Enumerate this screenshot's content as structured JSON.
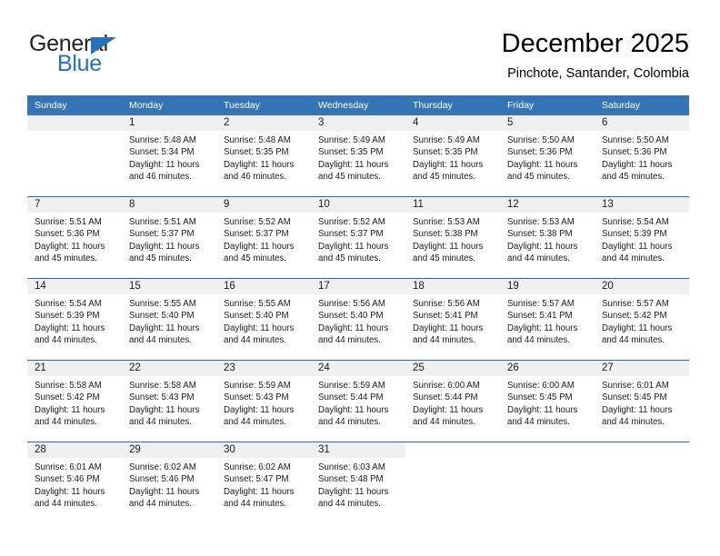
{
  "brand": {
    "name_top": "General",
    "name_bottom": "Blue",
    "color_blue": "#2572b8",
    "triangle_icon": "triangle-icon"
  },
  "header": {
    "title": "December 2025",
    "location": "Pinchote, Santander, Colombia"
  },
  "theme": {
    "header_blue": "#3575b5",
    "row_divider_blue": "#2a6ca8",
    "day_band_gray": "#f0f0f0"
  },
  "weekday_headers": [
    "Sunday",
    "Monday",
    "Tuesday",
    "Wednesday",
    "Thursday",
    "Friday",
    "Saturday"
  ],
  "weeks": [
    [
      {
        "blank": true
      },
      {
        "day": "1",
        "sunrise": "Sunrise: 5:48 AM",
        "sunset": "Sunset: 5:34 PM",
        "daylight_1": "Daylight: 11 hours",
        "daylight_2": "and 46 minutes."
      },
      {
        "day": "2",
        "sunrise": "Sunrise: 5:48 AM",
        "sunset": "Sunset: 5:35 PM",
        "daylight_1": "Daylight: 11 hours",
        "daylight_2": "and 46 minutes."
      },
      {
        "day": "3",
        "sunrise": "Sunrise: 5:49 AM",
        "sunset": "Sunset: 5:35 PM",
        "daylight_1": "Daylight: 11 hours",
        "daylight_2": "and 45 minutes."
      },
      {
        "day": "4",
        "sunrise": "Sunrise: 5:49 AM",
        "sunset": "Sunset: 5:35 PM",
        "daylight_1": "Daylight: 11 hours",
        "daylight_2": "and 45 minutes."
      },
      {
        "day": "5",
        "sunrise": "Sunrise: 5:50 AM",
        "sunset": "Sunset: 5:36 PM",
        "daylight_1": "Daylight: 11 hours",
        "daylight_2": "and 45 minutes."
      },
      {
        "day": "6",
        "sunrise": "Sunrise: 5:50 AM",
        "sunset": "Sunset: 5:36 PM",
        "daylight_1": "Daylight: 11 hours",
        "daylight_2": "and 45 minutes."
      }
    ],
    [
      {
        "day": "7",
        "sunrise": "Sunrise: 5:51 AM",
        "sunset": "Sunset: 5:36 PM",
        "daylight_1": "Daylight: 11 hours",
        "daylight_2": "and 45 minutes."
      },
      {
        "day": "8",
        "sunrise": "Sunrise: 5:51 AM",
        "sunset": "Sunset: 5:37 PM",
        "daylight_1": "Daylight: 11 hours",
        "daylight_2": "and 45 minutes."
      },
      {
        "day": "9",
        "sunrise": "Sunrise: 5:52 AM",
        "sunset": "Sunset: 5:37 PM",
        "daylight_1": "Daylight: 11 hours",
        "daylight_2": "and 45 minutes."
      },
      {
        "day": "10",
        "sunrise": "Sunrise: 5:52 AM",
        "sunset": "Sunset: 5:37 PM",
        "daylight_1": "Daylight: 11 hours",
        "daylight_2": "and 45 minutes."
      },
      {
        "day": "11",
        "sunrise": "Sunrise: 5:53 AM",
        "sunset": "Sunset: 5:38 PM",
        "daylight_1": "Daylight: 11 hours",
        "daylight_2": "and 45 minutes."
      },
      {
        "day": "12",
        "sunrise": "Sunrise: 5:53 AM",
        "sunset": "Sunset: 5:38 PM",
        "daylight_1": "Daylight: 11 hours",
        "daylight_2": "and 44 minutes."
      },
      {
        "day": "13",
        "sunrise": "Sunrise: 5:54 AM",
        "sunset": "Sunset: 5:39 PM",
        "daylight_1": "Daylight: 11 hours",
        "daylight_2": "and 44 minutes."
      }
    ],
    [
      {
        "day": "14",
        "sunrise": "Sunrise: 5:54 AM",
        "sunset": "Sunset: 5:39 PM",
        "daylight_1": "Daylight: 11 hours",
        "daylight_2": "and 44 minutes."
      },
      {
        "day": "15",
        "sunrise": "Sunrise: 5:55 AM",
        "sunset": "Sunset: 5:40 PM",
        "daylight_1": "Daylight: 11 hours",
        "daylight_2": "and 44 minutes."
      },
      {
        "day": "16",
        "sunrise": "Sunrise: 5:55 AM",
        "sunset": "Sunset: 5:40 PM",
        "daylight_1": "Daylight: 11 hours",
        "daylight_2": "and 44 minutes."
      },
      {
        "day": "17",
        "sunrise": "Sunrise: 5:56 AM",
        "sunset": "Sunset: 5:40 PM",
        "daylight_1": "Daylight: 11 hours",
        "daylight_2": "and 44 minutes."
      },
      {
        "day": "18",
        "sunrise": "Sunrise: 5:56 AM",
        "sunset": "Sunset: 5:41 PM",
        "daylight_1": "Daylight: 11 hours",
        "daylight_2": "and 44 minutes."
      },
      {
        "day": "19",
        "sunrise": "Sunrise: 5:57 AM",
        "sunset": "Sunset: 5:41 PM",
        "daylight_1": "Daylight: 11 hours",
        "daylight_2": "and 44 minutes."
      },
      {
        "day": "20",
        "sunrise": "Sunrise: 5:57 AM",
        "sunset": "Sunset: 5:42 PM",
        "daylight_1": "Daylight: 11 hours",
        "daylight_2": "and 44 minutes."
      }
    ],
    [
      {
        "day": "21",
        "sunrise": "Sunrise: 5:58 AM",
        "sunset": "Sunset: 5:42 PM",
        "daylight_1": "Daylight: 11 hours",
        "daylight_2": "and 44 minutes."
      },
      {
        "day": "22",
        "sunrise": "Sunrise: 5:58 AM",
        "sunset": "Sunset: 5:43 PM",
        "daylight_1": "Daylight: 11 hours",
        "daylight_2": "and 44 minutes."
      },
      {
        "day": "23",
        "sunrise": "Sunrise: 5:59 AM",
        "sunset": "Sunset: 5:43 PM",
        "daylight_1": "Daylight: 11 hours",
        "daylight_2": "and 44 minutes."
      },
      {
        "day": "24",
        "sunrise": "Sunrise: 5:59 AM",
        "sunset": "Sunset: 5:44 PM",
        "daylight_1": "Daylight: 11 hours",
        "daylight_2": "and 44 minutes."
      },
      {
        "day": "25",
        "sunrise": "Sunrise: 6:00 AM",
        "sunset": "Sunset: 5:44 PM",
        "daylight_1": "Daylight: 11 hours",
        "daylight_2": "and 44 minutes."
      },
      {
        "day": "26",
        "sunrise": "Sunrise: 6:00 AM",
        "sunset": "Sunset: 5:45 PM",
        "daylight_1": "Daylight: 11 hours",
        "daylight_2": "and 44 minutes."
      },
      {
        "day": "27",
        "sunrise": "Sunrise: 6:01 AM",
        "sunset": "Sunset: 5:45 PM",
        "daylight_1": "Daylight: 11 hours",
        "daylight_2": "and 44 minutes."
      }
    ],
    [
      {
        "day": "28",
        "sunrise": "Sunrise: 6:01 AM",
        "sunset": "Sunset: 5:46 PM",
        "daylight_1": "Daylight: 11 hours",
        "daylight_2": "and 44 minutes."
      },
      {
        "day": "29",
        "sunrise": "Sunrise: 6:02 AM",
        "sunset": "Sunset: 5:46 PM",
        "daylight_1": "Daylight: 11 hours",
        "daylight_2": "and 44 minutes."
      },
      {
        "day": "30",
        "sunrise": "Sunrise: 6:02 AM",
        "sunset": "Sunset: 5:47 PM",
        "daylight_1": "Daylight: 11 hours",
        "daylight_2": "and 44 minutes."
      },
      {
        "day": "31",
        "sunrise": "Sunrise: 6:03 AM",
        "sunset": "Sunset: 5:48 PM",
        "daylight_1": "Daylight: 11 hours",
        "daylight_2": "and 44 minutes."
      },
      {
        "empty": true
      },
      {
        "empty": true
      },
      {
        "empty": true
      }
    ]
  ]
}
